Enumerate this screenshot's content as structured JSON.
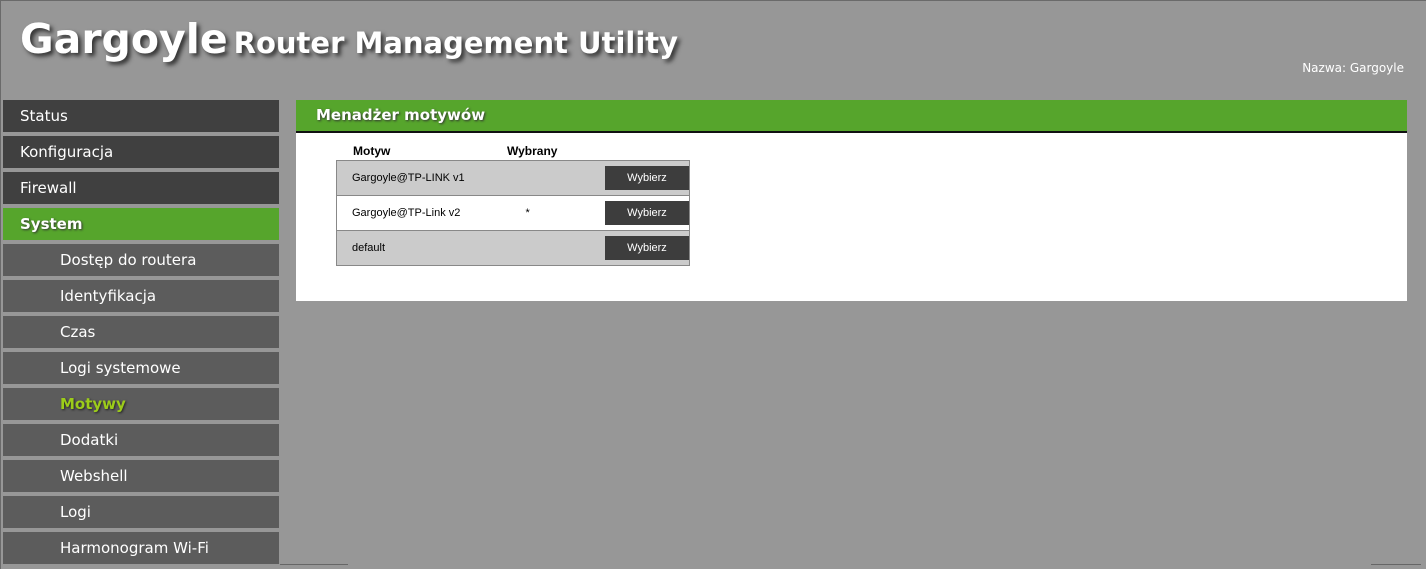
{
  "header": {
    "title_main": "Gargoyle",
    "title_sub": "Router Management Utility",
    "hostname": "Nazwa: Gargoyle"
  },
  "sidebar": {
    "items": [
      {
        "label": "Status"
      },
      {
        "label": "Konfiguracja"
      },
      {
        "label": "Firewall"
      },
      {
        "label": "System"
      },
      {
        "label": "Dostęp do routera"
      },
      {
        "label": "Identyfikacja"
      },
      {
        "label": "Czas"
      },
      {
        "label": "Logi systemowe"
      },
      {
        "label": "Motywy"
      },
      {
        "label": "Dodatki"
      },
      {
        "label": "Webshell"
      },
      {
        "label": "Logi"
      },
      {
        "label": "Harmonogram Wi-Fi"
      }
    ]
  },
  "panel": {
    "title": "Menadżer motywów",
    "columns": [
      "Motyw",
      "Wybrany"
    ],
    "rows": [
      {
        "name": "Gargoyle@TP-LINK v1",
        "selected": "",
        "button": "Wybierz"
      },
      {
        "name": "Gargoyle@TP-Link v2",
        "selected": "*",
        "button": "Wybierz"
      },
      {
        "name": "default",
        "selected": "",
        "button": "Wybierz"
      }
    ]
  }
}
